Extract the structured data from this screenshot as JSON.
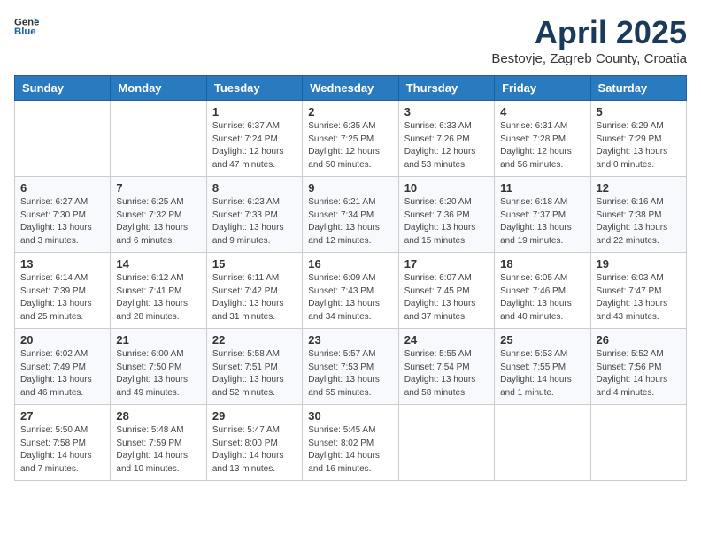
{
  "header": {
    "logo_general": "General",
    "logo_blue": "Blue",
    "month_title": "April 2025",
    "location": "Bestovje, Zagreb County, Croatia"
  },
  "weekdays": [
    "Sunday",
    "Monday",
    "Tuesday",
    "Wednesday",
    "Thursday",
    "Friday",
    "Saturday"
  ],
  "weeks": [
    [
      {
        "day": "",
        "info": ""
      },
      {
        "day": "",
        "info": ""
      },
      {
        "day": "1",
        "info": "Sunrise: 6:37 AM\nSunset: 7:24 PM\nDaylight: 12 hours and 47 minutes."
      },
      {
        "day": "2",
        "info": "Sunrise: 6:35 AM\nSunset: 7:25 PM\nDaylight: 12 hours and 50 minutes."
      },
      {
        "day": "3",
        "info": "Sunrise: 6:33 AM\nSunset: 7:26 PM\nDaylight: 12 hours and 53 minutes."
      },
      {
        "day": "4",
        "info": "Sunrise: 6:31 AM\nSunset: 7:28 PM\nDaylight: 12 hours and 56 minutes."
      },
      {
        "day": "5",
        "info": "Sunrise: 6:29 AM\nSunset: 7:29 PM\nDaylight: 13 hours and 0 minutes."
      }
    ],
    [
      {
        "day": "6",
        "info": "Sunrise: 6:27 AM\nSunset: 7:30 PM\nDaylight: 13 hours and 3 minutes."
      },
      {
        "day": "7",
        "info": "Sunrise: 6:25 AM\nSunset: 7:32 PM\nDaylight: 13 hours and 6 minutes."
      },
      {
        "day": "8",
        "info": "Sunrise: 6:23 AM\nSunset: 7:33 PM\nDaylight: 13 hours and 9 minutes."
      },
      {
        "day": "9",
        "info": "Sunrise: 6:21 AM\nSunset: 7:34 PM\nDaylight: 13 hours and 12 minutes."
      },
      {
        "day": "10",
        "info": "Sunrise: 6:20 AM\nSunset: 7:36 PM\nDaylight: 13 hours and 15 minutes."
      },
      {
        "day": "11",
        "info": "Sunrise: 6:18 AM\nSunset: 7:37 PM\nDaylight: 13 hours and 19 minutes."
      },
      {
        "day": "12",
        "info": "Sunrise: 6:16 AM\nSunset: 7:38 PM\nDaylight: 13 hours and 22 minutes."
      }
    ],
    [
      {
        "day": "13",
        "info": "Sunrise: 6:14 AM\nSunset: 7:39 PM\nDaylight: 13 hours and 25 minutes."
      },
      {
        "day": "14",
        "info": "Sunrise: 6:12 AM\nSunset: 7:41 PM\nDaylight: 13 hours and 28 minutes."
      },
      {
        "day": "15",
        "info": "Sunrise: 6:11 AM\nSunset: 7:42 PM\nDaylight: 13 hours and 31 minutes."
      },
      {
        "day": "16",
        "info": "Sunrise: 6:09 AM\nSunset: 7:43 PM\nDaylight: 13 hours and 34 minutes."
      },
      {
        "day": "17",
        "info": "Sunrise: 6:07 AM\nSunset: 7:45 PM\nDaylight: 13 hours and 37 minutes."
      },
      {
        "day": "18",
        "info": "Sunrise: 6:05 AM\nSunset: 7:46 PM\nDaylight: 13 hours and 40 minutes."
      },
      {
        "day": "19",
        "info": "Sunrise: 6:03 AM\nSunset: 7:47 PM\nDaylight: 13 hours and 43 minutes."
      }
    ],
    [
      {
        "day": "20",
        "info": "Sunrise: 6:02 AM\nSunset: 7:49 PM\nDaylight: 13 hours and 46 minutes."
      },
      {
        "day": "21",
        "info": "Sunrise: 6:00 AM\nSunset: 7:50 PM\nDaylight: 13 hours and 49 minutes."
      },
      {
        "day": "22",
        "info": "Sunrise: 5:58 AM\nSunset: 7:51 PM\nDaylight: 13 hours and 52 minutes."
      },
      {
        "day": "23",
        "info": "Sunrise: 5:57 AM\nSunset: 7:53 PM\nDaylight: 13 hours and 55 minutes."
      },
      {
        "day": "24",
        "info": "Sunrise: 5:55 AM\nSunset: 7:54 PM\nDaylight: 13 hours and 58 minutes."
      },
      {
        "day": "25",
        "info": "Sunrise: 5:53 AM\nSunset: 7:55 PM\nDaylight: 14 hours and 1 minute."
      },
      {
        "day": "26",
        "info": "Sunrise: 5:52 AM\nSunset: 7:56 PM\nDaylight: 14 hours and 4 minutes."
      }
    ],
    [
      {
        "day": "27",
        "info": "Sunrise: 5:50 AM\nSunset: 7:58 PM\nDaylight: 14 hours and 7 minutes."
      },
      {
        "day": "28",
        "info": "Sunrise: 5:48 AM\nSunset: 7:59 PM\nDaylight: 14 hours and 10 minutes."
      },
      {
        "day": "29",
        "info": "Sunrise: 5:47 AM\nSunset: 8:00 PM\nDaylight: 14 hours and 13 minutes."
      },
      {
        "day": "30",
        "info": "Sunrise: 5:45 AM\nSunset: 8:02 PM\nDaylight: 14 hours and 16 minutes."
      },
      {
        "day": "",
        "info": ""
      },
      {
        "day": "",
        "info": ""
      },
      {
        "day": "",
        "info": ""
      }
    ]
  ]
}
